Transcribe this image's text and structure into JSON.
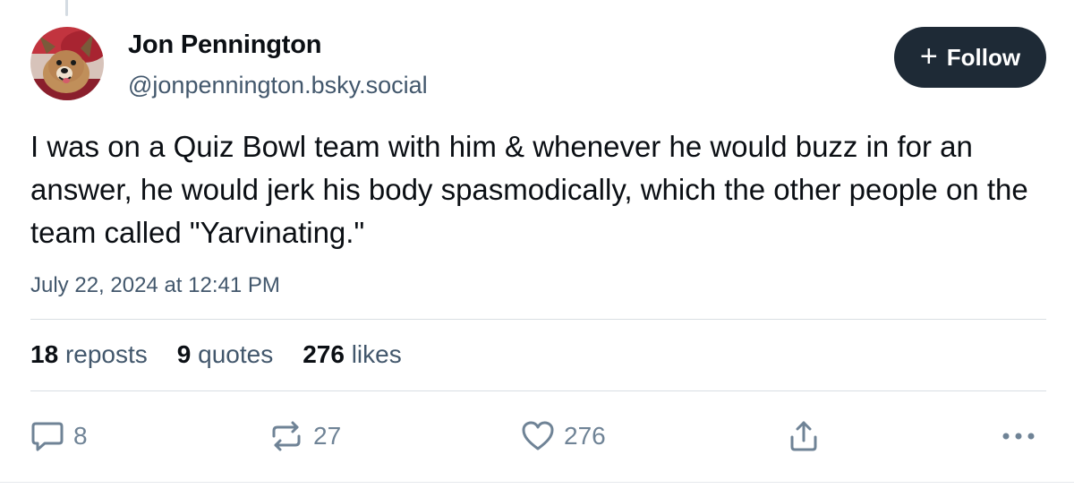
{
  "author": {
    "display_name": "Jon Pennington",
    "handle": "@jonpennington.bsky.social",
    "avatar_icon": "dog-avatar"
  },
  "follow_button": {
    "label": "Follow",
    "icon": "plus-icon"
  },
  "post": {
    "text": "I was on a Quiz Bowl team with him & whenever he would buzz in for an answer, he would jerk his body spasmodically, which the other people on the team called \"Yarvinating.\"",
    "timestamp": "July 22, 2024 at 12:41 PM"
  },
  "stats": {
    "reposts_count": "18",
    "reposts_label": "reposts",
    "quotes_count": "9",
    "quotes_label": "quotes",
    "likes_count": "276",
    "likes_label": "likes"
  },
  "actions": {
    "reply_count": "8",
    "repost_count": "27",
    "like_count": "276"
  },
  "colors": {
    "follow_button_bg": "#1e2a36",
    "secondary_text": "#42576c",
    "action_icon": "#6f8396"
  }
}
